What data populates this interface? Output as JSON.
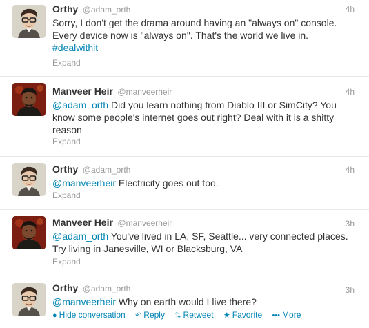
{
  "tweets": [
    {
      "fullname": "Orthy",
      "username": "@adam_orth",
      "time": "4h",
      "text": "Sorry, I don't get the drama around having an \"always on\" console. Every device now is \"always on\". That's the world we live in.",
      "hashtag": "#dealwithit",
      "expand": "Expand",
      "avatar_icon": "orthy-avatar"
    },
    {
      "fullname": "Manveer Heir",
      "username": "@manveerheir",
      "time": "4h",
      "mention": "@adam_orth",
      "text": " Did you learn nothing from Diablo III or SimCity? You know some people's internet goes out right? Deal with it is a shitty reason",
      "expand": "Expand",
      "avatar_icon": "manveer-avatar"
    },
    {
      "fullname": "Orthy",
      "username": "@adam_orth",
      "time": "4h",
      "mention": "@manveerheir",
      "text": " Electricity goes out too.",
      "expand": "Expand",
      "avatar_icon": "orthy-avatar"
    },
    {
      "fullname": "Manveer Heir",
      "username": "@manveerheir",
      "time": "3h",
      "mention": "@adam_orth",
      "text": " You've lived in LA, SF, Seattle... very connected places. Try living in Janesville, WI or Blacksburg, VA",
      "expand": "Expand",
      "avatar_icon": "manveer-avatar"
    },
    {
      "fullname": "Orthy",
      "username": "@adam_orth",
      "time": "3h",
      "mention": "@manveerheir",
      "text": " Why on earth would I live there?",
      "avatar_icon": "orthy-avatar",
      "actions": {
        "hide_conversation": "Hide conversation",
        "reply": "Reply",
        "retweet": "Retweet",
        "favorite": "Favorite",
        "more": "More"
      }
    }
  ],
  "colors": {
    "link": "#0084b4",
    "muted": "#999999",
    "text": "#333333",
    "divider": "#e8e8e8"
  }
}
